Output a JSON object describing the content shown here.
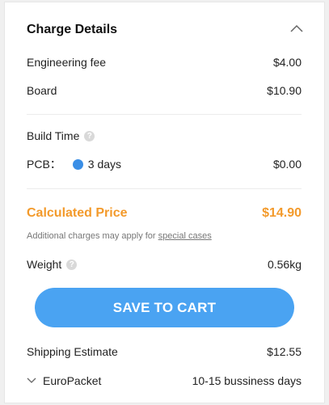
{
  "header": {
    "title": "Charge Details",
    "collapse_icon": "chevron-up-icon"
  },
  "charges": {
    "engineering_fee_label": "Engineering fee",
    "engineering_fee_value": "$4.00",
    "board_label": "Board",
    "board_value": "$10.90"
  },
  "build_time": {
    "label": "Build Time",
    "help_icon": "question-circle-icon",
    "pcb_label": "PCB：",
    "pcb_option": "3 days",
    "pcb_value": "$0.00"
  },
  "calculated": {
    "label": "Calculated Price",
    "value": "$14.90",
    "note_prefix": "Additional charges may apply for ",
    "note_link": "special cases"
  },
  "weight": {
    "label": "Weight",
    "help_icon": "question-circle-icon",
    "value": "0.56kg"
  },
  "cart": {
    "button_label": "SAVE TO CART"
  },
  "shipping": {
    "label": "Shipping Estimate",
    "value": "$12.55",
    "method_label": "EuroPacket",
    "method_icon": "chevron-down-icon",
    "method_time": "10-15 bussiness days"
  },
  "colors": {
    "accent_orange": "#f39a2b",
    "button_blue": "#4aa3f2",
    "radio_blue": "#3a8ee6"
  }
}
